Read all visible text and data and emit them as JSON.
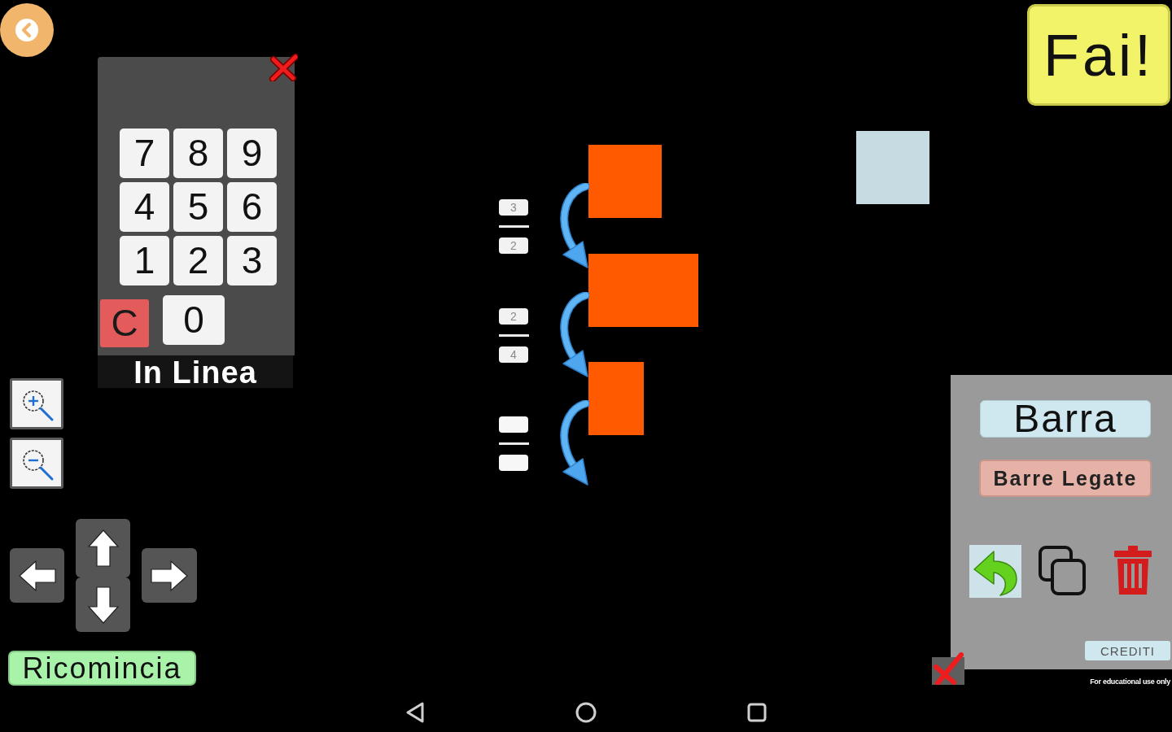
{
  "keypad": {
    "key_rows": [
      [
        {
          "label": "7",
          "kind": "digit"
        },
        {
          "label": "8",
          "kind": "digit"
        },
        {
          "label": "9",
          "kind": "digit"
        }
      ],
      [
        {
          "label": "4",
          "kind": "digit"
        },
        {
          "label": "5",
          "kind": "digit"
        },
        {
          "label": "6",
          "kind": "digit"
        }
      ],
      [
        {
          "label": "1",
          "kind": "digit"
        },
        {
          "label": "2",
          "kind": "digit"
        },
        {
          "label": "3",
          "kind": "digit"
        }
      ],
      [
        {
          "label": "C",
          "kind": "clear"
        },
        {
          "label": "0",
          "kind": "digit"
        }
      ]
    ],
    "mode_label": "In Linea"
  },
  "restart_button": {
    "label": "Ricomincia"
  },
  "canvas": {
    "steps": [
      {
        "kind": "fraction",
        "numerator": "3",
        "denominator": "2"
      },
      {
        "kind": "fraction",
        "numerator": "2",
        "denominator": "4"
      },
      {
        "kind": "blank"
      }
    ]
  },
  "do_button": {
    "label": "Fai!"
  },
  "tool_panel": {
    "modes": [
      {
        "label": "Barra",
        "kind": "bar"
      },
      {
        "label": "Barre Legate",
        "kind": "linked"
      }
    ],
    "credits_button": {
      "label": "CREDITI"
    }
  },
  "footer_note": "For educational use only"
}
